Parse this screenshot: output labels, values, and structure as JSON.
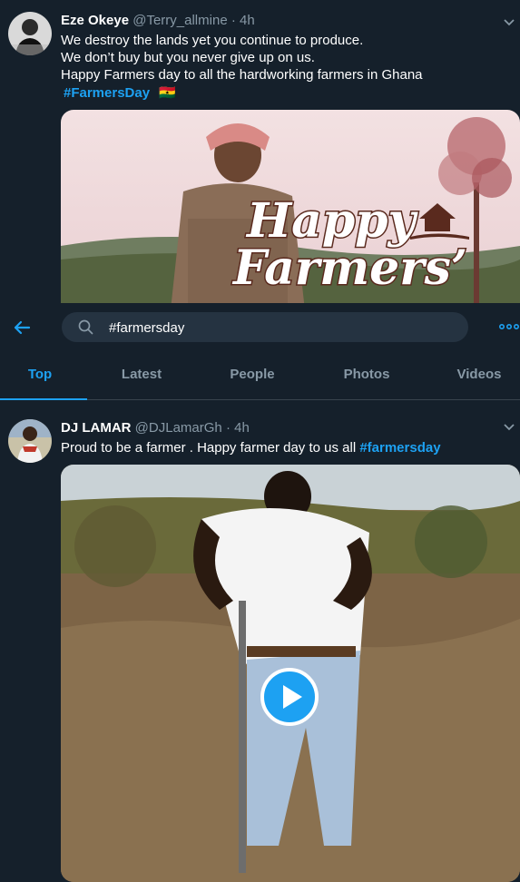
{
  "tweets": [
    {
      "name": "Eze Okeye",
      "handle": "@Terry_allmine",
      "separator": "·",
      "time": "4h",
      "lines": [
        "We destroy the lands yet you continue to produce.",
        "We don’t buy but you never give up on us.",
        "Happy Farmers day to all the hardworking farmers in Ghana"
      ],
      "hashtag": "#FarmersDay",
      "flag": "🇬🇭",
      "media_text_line1": "Happy",
      "media_text_line2": "Farmers’"
    },
    {
      "name": "DJ LAMAR",
      "handle": "@DJLamarGh",
      "separator": "·",
      "time": "4h",
      "text": "Proud to be a farmer . Happy farmer day to us all ",
      "hashtag": "#farmersday"
    }
  ],
  "search": {
    "value": "#farmersday"
  },
  "tabs": [
    "Top",
    "Latest",
    "People",
    "Photos",
    "Videos"
  ],
  "active_tab": "Top",
  "colors": {
    "background": "#15202b",
    "accent": "#1da1f2",
    "muted": "#8899a6",
    "input_bg": "#253341"
  }
}
